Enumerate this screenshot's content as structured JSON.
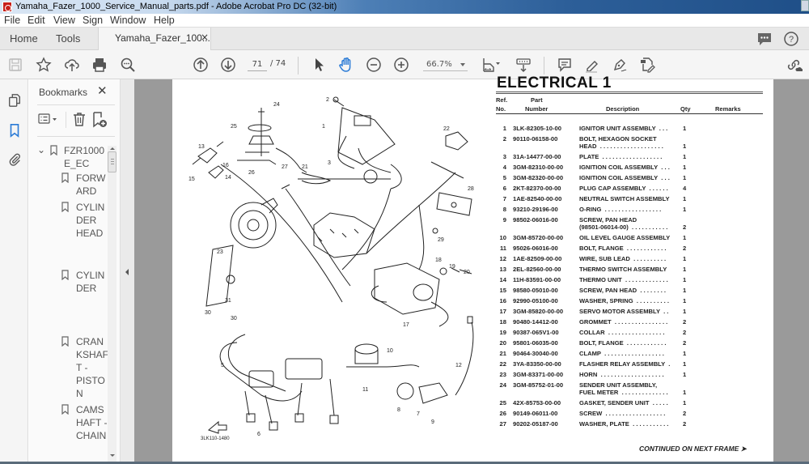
{
  "window": {
    "title": "Yamaha_Fazer_1000_Service_Manual_parts.pdf - Adobe Acrobat Pro DC (32-bit)"
  },
  "menu": [
    "File",
    "Edit",
    "View",
    "Sign",
    "Window",
    "Help"
  ],
  "tabs": {
    "home": "Home",
    "tools": "Tools",
    "document": "Yamaha_Fazer_100...",
    "close": "×"
  },
  "toolbar": {
    "current_page": "71",
    "total_pages": "/ 74",
    "zoom": "66.7%"
  },
  "bookmarks": {
    "title": "Bookmarks",
    "close": "✕",
    "items": [
      {
        "label": "FZR1000\nE_EC",
        "level": 0,
        "expanded": true
      },
      {
        "label": "FORW\nARD",
        "level": 1
      },
      {
        "label": "CYLIN\nDER\nHEAD",
        "level": 1
      },
      {
        "label": "CYLIN\nDER",
        "level": 1
      },
      {
        "label": "CRAN\nKSHAF\nT -\nPISTO\nN",
        "level": 1
      },
      {
        "label": "CAMS\nHAFT -\nCHAIN",
        "level": 1
      }
    ]
  },
  "document": {
    "section_title": "ELECTRICAL 1",
    "diagram_code": "3LK110-1480",
    "headers": {
      "ref_line1": "Ref.",
      "ref_line2": "No.",
      "part_line1": "Part",
      "part_line2": "Number",
      "description": "Description",
      "qty": "Qty",
      "remarks": "Remarks"
    },
    "parts": [
      {
        "ref": "1",
        "part_number": "3LK-82305-10-00",
        "description": "IGNITOR UNIT ASSEMBLY  . . .",
        "qty": "1"
      },
      {
        "ref": "2",
        "part_number": "90110-06158-00",
        "description": "BOLT, HEXAGON SOCKET\nHEAD  . . . . . . . . . . . . . . . . . . .",
        "qty": "1"
      },
      {
        "ref": "3",
        "part_number": "31A-14477-00-00",
        "description": "PLATE  . . . . . . . . . . . . . . . . . .",
        "qty": "1"
      },
      {
        "ref": "4",
        "part_number": "3GM-82310-00-00",
        "description": "IGNITION COIL ASSEMBLY  . . .",
        "qty": "1"
      },
      {
        "ref": "5",
        "part_number": "3GM-82320-00-00",
        "description": "IGNITION COIL ASSEMBLY  . . .",
        "qty": "1"
      },
      {
        "ref": "6",
        "part_number": "2KT-82370-00-00",
        "description": "PLUG CAP ASSEMBLY  . . . . . .",
        "qty": "4"
      },
      {
        "ref": "7",
        "part_number": "1AE-82540-00-00",
        "description": "NEUTRAL SWITCH ASSEMBLY",
        "qty": "1"
      },
      {
        "ref": "8",
        "part_number": "93210-29196-00",
        "description": "O-RING  . . . . . . . . . . . . . . . . .",
        "qty": "1"
      },
      {
        "ref": "9",
        "part_number": "98502-06016-00",
        "description": "SCREW, PAN HEAD\n(98501-06014-00)  . . . . . . . . . . .",
        "qty": "2"
      },
      {
        "ref": "10",
        "part_number": "3GM-85720-00-00",
        "description": "OIL LEVEL GAUGE ASSEMBLY",
        "qty": "1"
      },
      {
        "ref": "11",
        "part_number": "95026-06016-00",
        "description": "BOLT, FLANGE  . . . . . . . . . . . .",
        "qty": "2"
      },
      {
        "ref": "12",
        "part_number": "1AE-82509-00-00",
        "description": "WIRE, SUB LEAD  . . . . . . . . . .",
        "qty": "1"
      },
      {
        "ref": "13",
        "part_number": "2EL-82560-00-00",
        "description": "THERMO SWITCH ASSEMBLY",
        "qty": "1"
      },
      {
        "ref": "14",
        "part_number": "11H-83591-00-00",
        "description": "THERMO UNIT  . . . . . . . . . . . . .",
        "qty": "1"
      },
      {
        "ref": "15",
        "part_number": "98580-05010-00",
        "description": "SCREW, PAN HEAD  . . . . . . . .",
        "qty": "1"
      },
      {
        "ref": "16",
        "part_number": "92990-05100-00",
        "description": "WASHER, SPRING  . . . . . . . . . .",
        "qty": "1"
      },
      {
        "ref": "17",
        "part_number": "3GM-85820-00-00",
        "description": "SERVO MOTOR ASSEMBLY  . .",
        "qty": "1"
      },
      {
        "ref": "18",
        "part_number": "90480-14412-00",
        "description": "GROMMET  . . . . . . . . . . . . . . . .",
        "qty": "2"
      },
      {
        "ref": "19",
        "part_number": "90387-065V1-00",
        "description": "COLLAR  . . . . . . . . . . . . . . . . .",
        "qty": "2"
      },
      {
        "ref": "20",
        "part_number": "95801-06035-00",
        "description": "BOLT, FLANGE  . . . . . . . . . . . .",
        "qty": "2"
      },
      {
        "ref": "21",
        "part_number": "90464-30040-00",
        "description": "CLAMP  . . . . . . . . . . . . . . . . . .",
        "qty": "1"
      },
      {
        "ref": "22",
        "part_number": "3YA-83350-00-00",
        "description": "FLASHER RELAY ASSEMBLY  .",
        "qty": "1"
      },
      {
        "ref": "23",
        "part_number": "3GM-83371-00-00",
        "description": "HORN  . . . . . . . . . . . . . . . . . . .",
        "qty": "1"
      },
      {
        "ref": "24",
        "part_number": "3GM-85752-01-00",
        "description": "SENDER UNIT ASSEMBLY,\nFUEL METER  . . . . . . . . . . . . . .",
        "qty": "1"
      },
      {
        "ref": "25",
        "part_number": "42X-85753-00-00",
        "description": "GASKET, SENDER UNIT  . . . . .",
        "qty": "1"
      },
      {
        "ref": "26",
        "part_number": "90149-06011-00",
        "description": "SCREW  . . . . . . . . . . . . . . . . . .",
        "qty": "2"
      },
      {
        "ref": "27",
        "part_number": "90202-05187-00",
        "description": "WASHER, PLATE  . . . . . . . . . . .",
        "qty": "2"
      }
    ],
    "continued": "CONTINUED ON NEXT FRAME ➤",
    "diagram_callouts": [
      "1",
      "2",
      "3",
      "5",
      "6",
      "6",
      "7",
      "8",
      "9",
      "10",
      "11",
      "12",
      "13",
      "14",
      "15",
      "16",
      "17",
      "18",
      "19",
      "20",
      "21",
      "22",
      "23",
      "24",
      "25",
      "26",
      "27",
      "28",
      "29",
      "30",
      "30",
      "31"
    ]
  },
  "colors": {
    "accent_blue": "#2b7bd6",
    "pdf_red": "#c8201a"
  }
}
